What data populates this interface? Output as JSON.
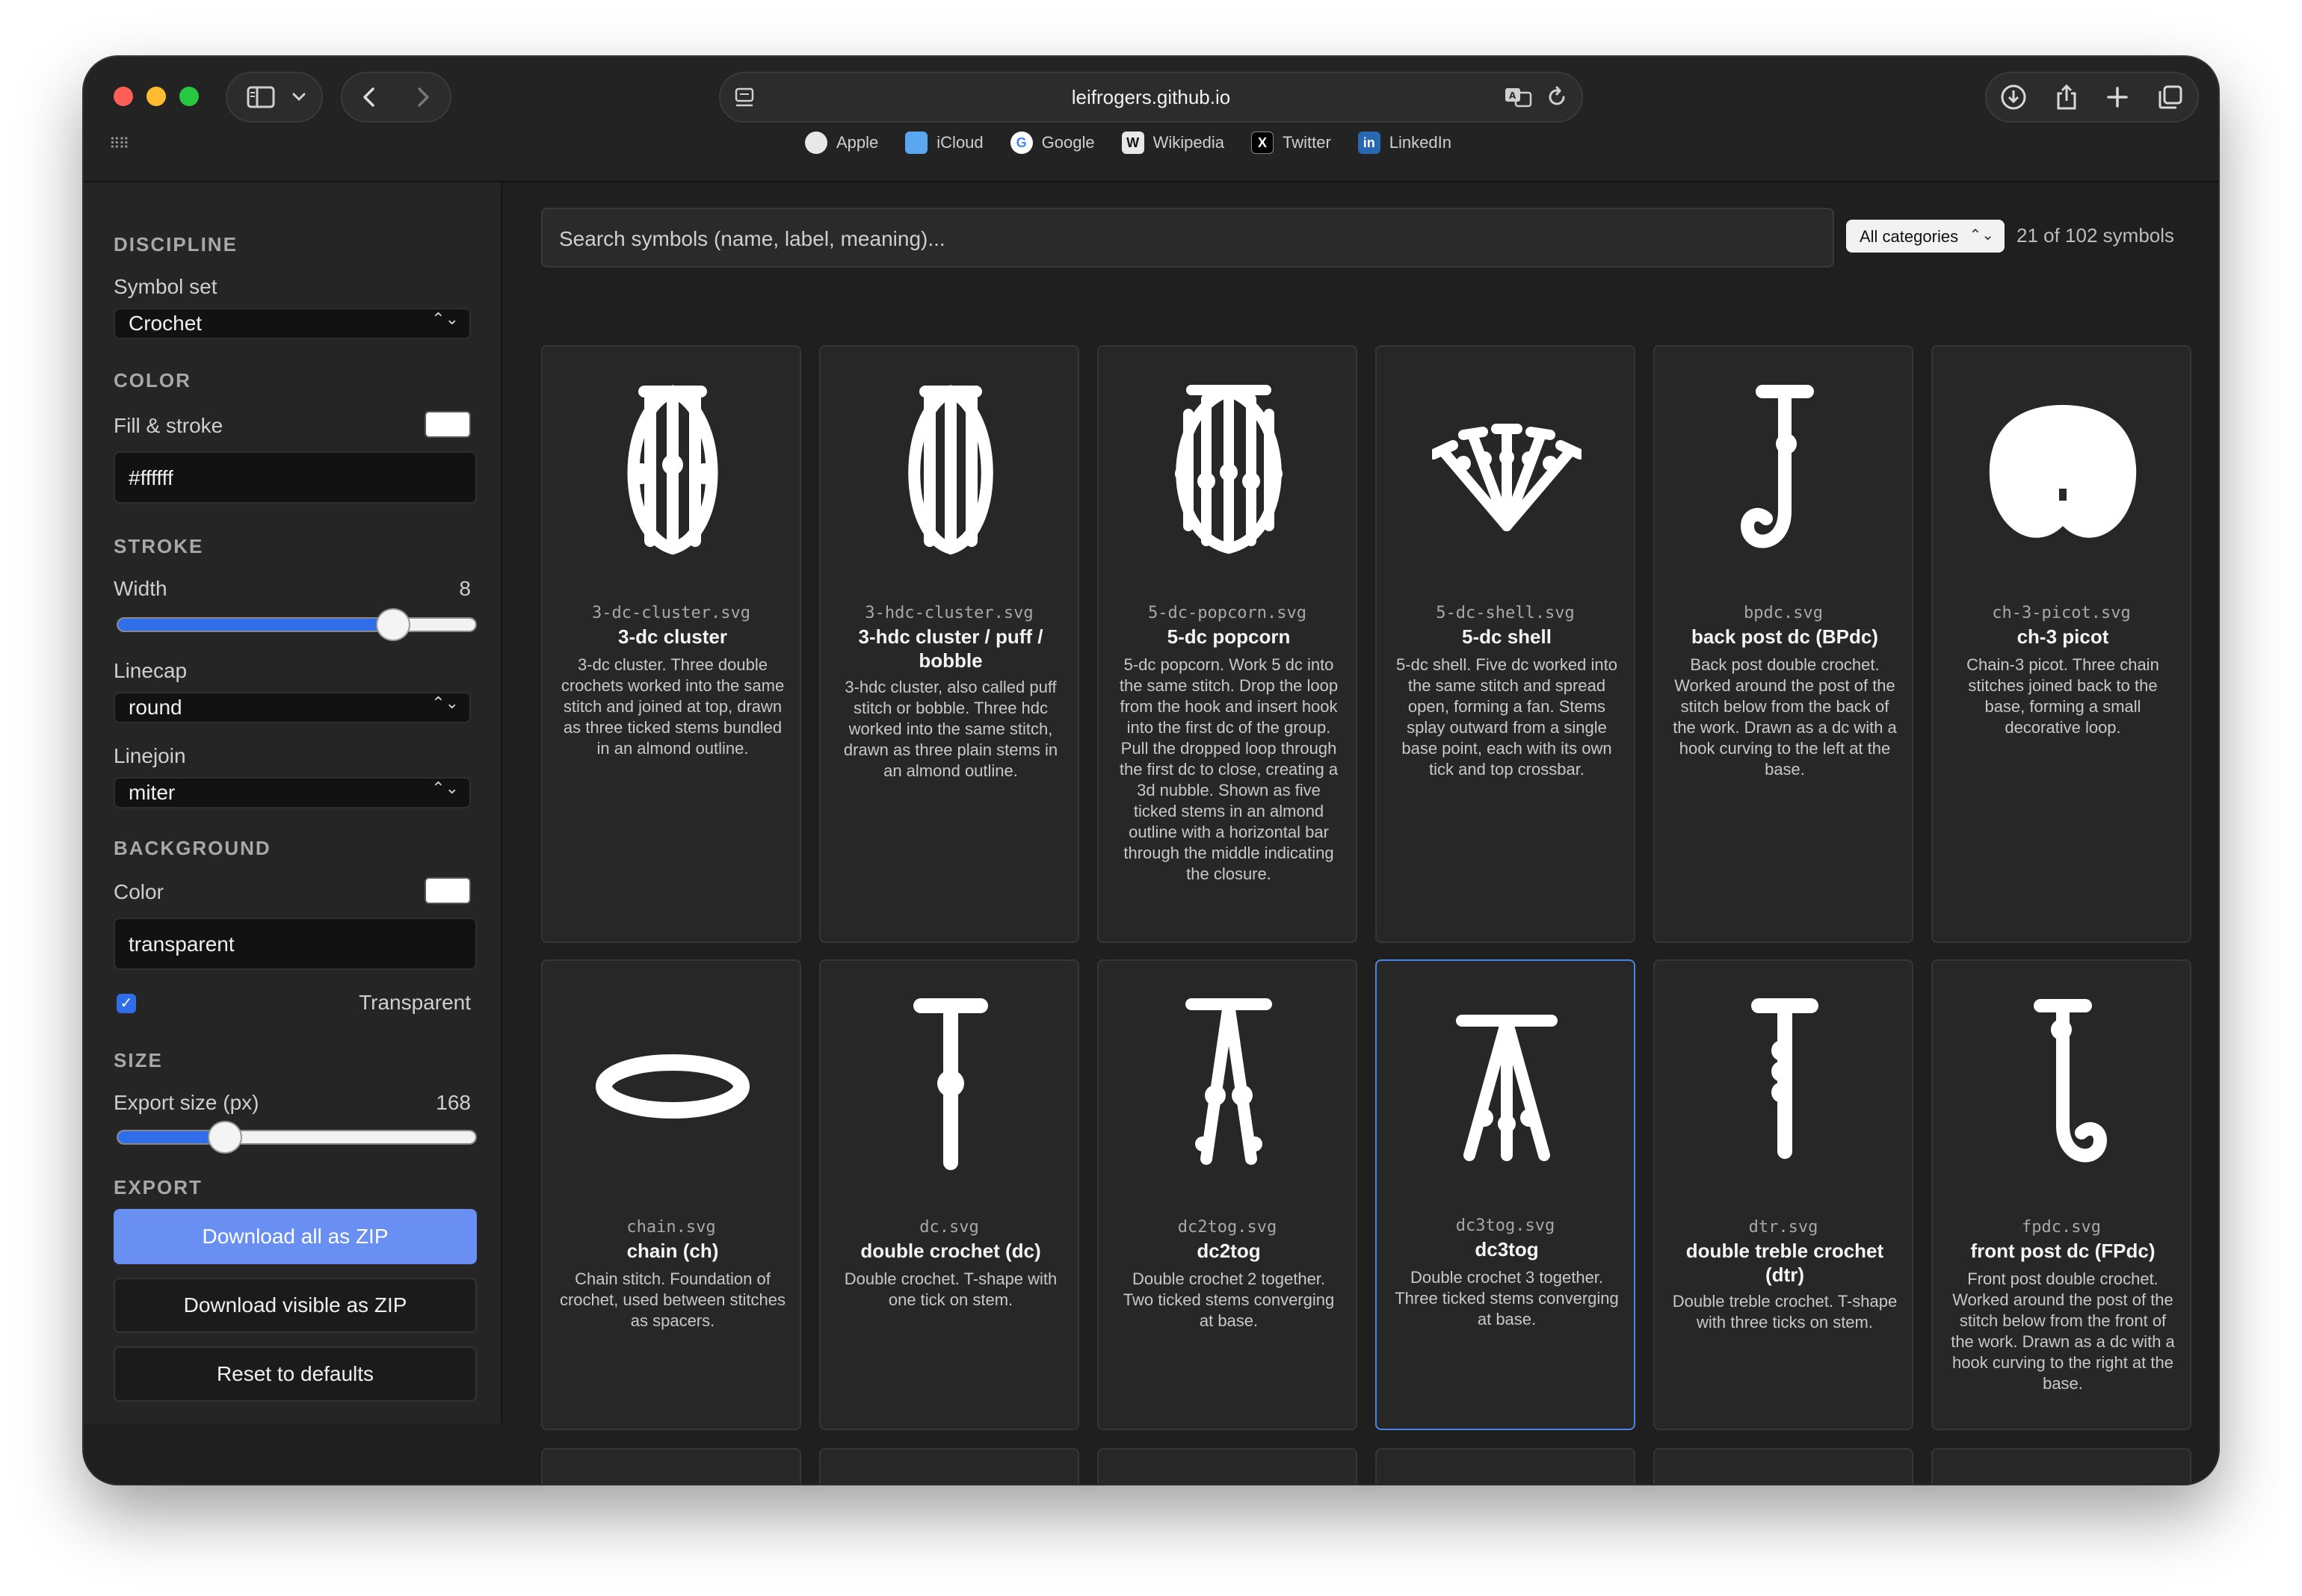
{
  "browser": {
    "url": "leifrogers.github.io",
    "favorites": [
      {
        "label": "Apple",
        "icon": "apple-icon"
      },
      {
        "label": "iCloud",
        "icon": "icloud-icon"
      },
      {
        "label": "Google",
        "icon": "google-icon"
      },
      {
        "label": "Wikipedia",
        "icon": "wikipedia-icon"
      },
      {
        "label": "Twitter",
        "icon": "twitter-icon"
      },
      {
        "label": "LinkedIn",
        "icon": "linkedin-icon"
      }
    ]
  },
  "sidebar": {
    "discipline_heading": "DISCIPLINE",
    "symbol_set_label": "Symbol set",
    "symbol_set_value": "Crochet",
    "color_heading": "COLOR",
    "fill_stroke_label": "Fill & stroke",
    "fill_stroke_value": "#ffffff",
    "stroke_heading": "STROKE",
    "width_label": "Width",
    "width_value": "8",
    "width_fraction": 0.77,
    "linecap_label": "Linecap",
    "linecap_value": "round",
    "linejoin_label": "Linejoin",
    "linejoin_value": "miter",
    "background_heading": "BACKGROUND",
    "bg_color_label": "Color",
    "bg_color_value": "transparent",
    "transparent_label": "Transparent",
    "transparent_checked": true,
    "size_heading": "SIZE",
    "export_size_label": "Export size (px)",
    "export_size_value": "168",
    "export_size_fraction": 0.3,
    "export_heading": "EXPORT",
    "download_all": "Download all as ZIP",
    "download_visible": "Download visible as ZIP",
    "reset": "Reset to defaults"
  },
  "main": {
    "search_placeholder": "Search symbols (name, label, meaning)...",
    "category_value": "All categories",
    "count_text": "21 of 102 symbols",
    "cards": [
      {
        "file": "3-dc-cluster.svg",
        "name": "3-dc cluster",
        "desc": "3-dc cluster. Three double crochets worked into the same stitch and joined at top, drawn as three ticked stems bundled in an almond outline."
      },
      {
        "file": "3-hdc-cluster.svg",
        "name": "3-hdc cluster / puff / bobble",
        "desc": "3-hdc cluster, also called puff stitch or bobble. Three hdc worked into the same stitch, drawn as three plain stems in an almond outline."
      },
      {
        "file": "5-dc-popcorn.svg",
        "name": "5-dc popcorn",
        "desc": "5-dc popcorn. Work 5 dc into the same stitch. Drop the loop from the hook and insert hook into the first dc of the group. Pull the dropped loop through the first dc to close, creating a 3d nubble. Shown as five ticked stems in an almond outline with a horizontal bar through the middle indicating the closure."
      },
      {
        "file": "5-dc-shell.svg",
        "name": "5-dc shell",
        "desc": "5-dc shell. Five dc worked into the same stitch and spread open, forming a fan. Stems splay outward from a single base point, each with its own tick and top crossbar."
      },
      {
        "file": "bpdc.svg",
        "name": "back post dc (BPdc)",
        "desc": "Back post double crochet. Worked around the post of the stitch below from the back of the work. Drawn as a dc with a hook curving to the left at the base."
      },
      {
        "file": "ch-3-picot.svg",
        "name": "ch-3 picot",
        "desc": "Chain-3 picot. Three chain stitches joined back to the base, forming a small decorative loop."
      },
      {
        "file": "chain.svg",
        "name": "chain (ch)",
        "desc": "Chain stitch. Foundation of crochet, used between stitches as spacers."
      },
      {
        "file": "dc.svg",
        "name": "double crochet (dc)",
        "desc": "Double crochet. T-shape with one tick on stem."
      },
      {
        "file": "dc2tog.svg",
        "name": "dc2tog",
        "desc": "Double crochet 2 together. Two ticked stems converging at base."
      },
      {
        "file": "dc3tog.svg",
        "name": "dc3tog",
        "desc": "Double crochet 3 together. Three ticked stems converging at base."
      },
      {
        "file": "dtr.svg",
        "name": "double treble crochet (dtr)",
        "desc": "Double treble crochet. T-shape with three ticks on stem."
      },
      {
        "file": "fpdc.svg",
        "name": "front post dc (FPdc)",
        "desc": "Front post double crochet. Worked around the post of the stitch below from the front of the work. Drawn as a dc with a hook curving to the right at the base."
      }
    ]
  }
}
